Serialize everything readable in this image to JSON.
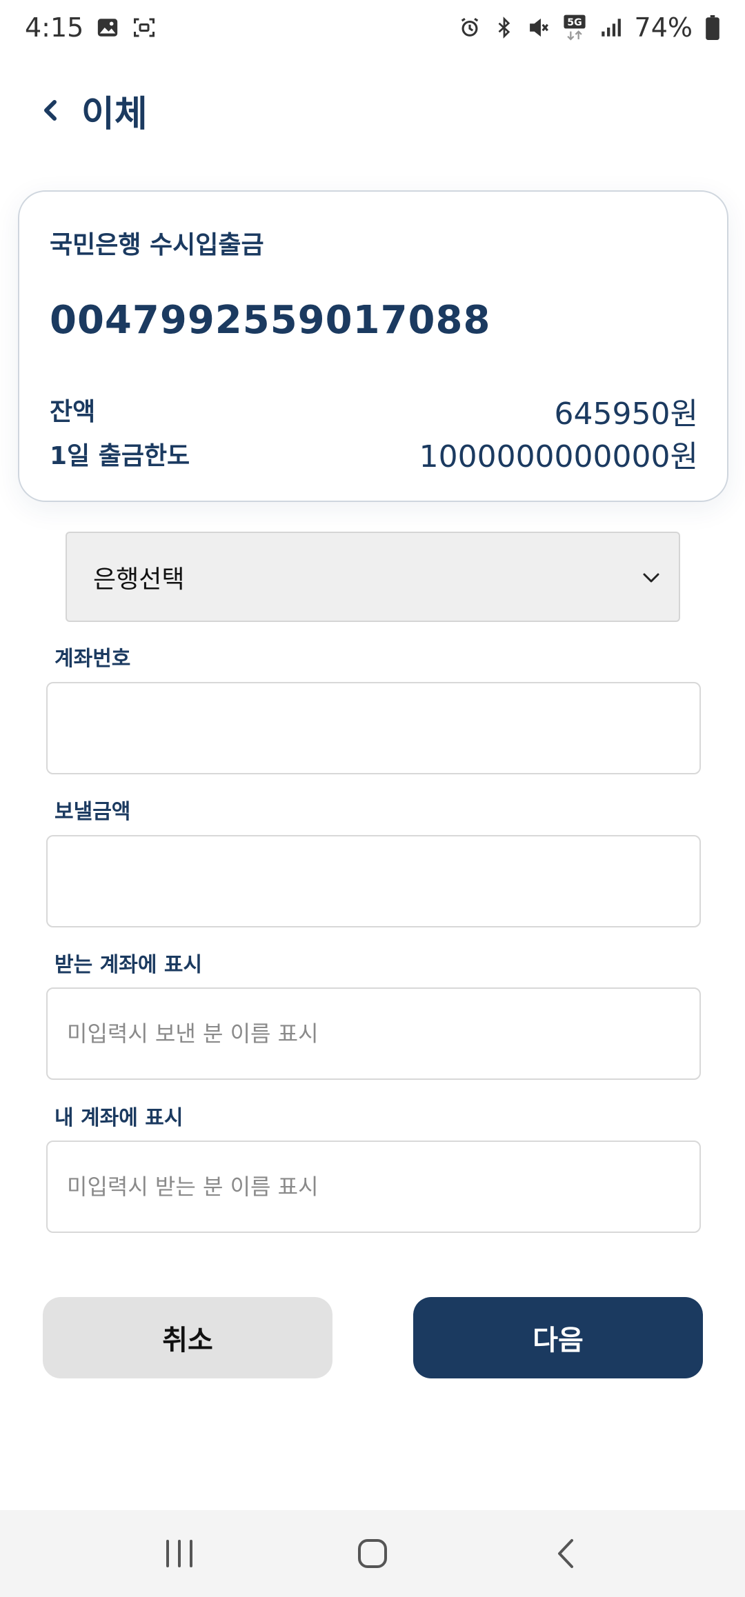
{
  "status_bar": {
    "time": "4:15",
    "battery_percent": "74%",
    "left_icons": [
      "image-icon",
      "screenshot-icon"
    ],
    "right_icons": [
      "alarm-icon",
      "bluetooth-icon",
      "mute-icon",
      "5g-icon",
      "signal-icon",
      "battery-icon"
    ],
    "network_badge": "5G"
  },
  "header": {
    "title": "이체"
  },
  "account_card": {
    "account_name": "국민은행 수시입출금",
    "account_number": "0047992559017088",
    "balance_label": "잔액",
    "balance_value": "645950원",
    "limit_label": "1일 출금한도",
    "limit_value": "1000000000000원"
  },
  "bank_select": {
    "selected": "은행선택"
  },
  "form": {
    "account_number_label": "계좌번호",
    "account_number_value": "",
    "amount_label": "보낼금액",
    "amount_value": "",
    "recipient_memo_label": "받는 계좌에 표시",
    "recipient_memo_placeholder": "미입력시 보낸 분 이름 표시",
    "my_memo_label": "내 계좌에 표시",
    "my_memo_placeholder": "미입력시 받는 분 이름 표시"
  },
  "buttons": {
    "cancel_label": "취소",
    "next_label": "다음"
  },
  "colors": {
    "primary": "#1b3a60",
    "cancel_bg": "#e2e2e2",
    "select_bg": "#efefef"
  }
}
